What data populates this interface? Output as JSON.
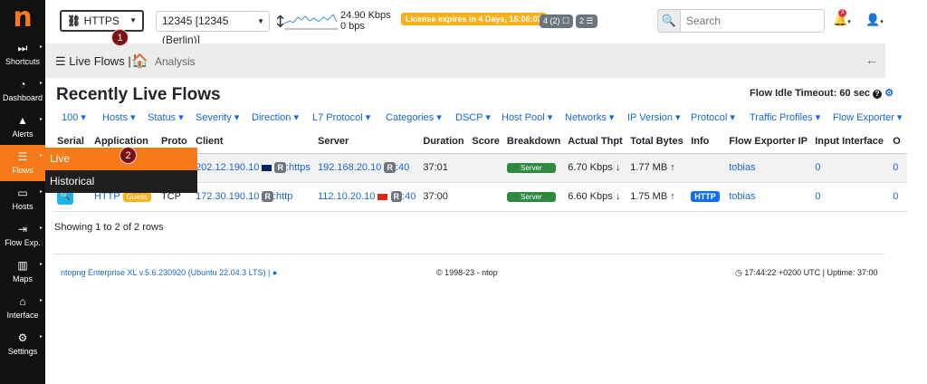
{
  "sidebar": {
    "logo": "n",
    "items": [
      {
        "label": "Shortcuts",
        "icon": "fast-forward-icon"
      },
      {
        "label": "Dashboard",
        "icon": "gauge-icon"
      },
      {
        "label": "Alerts",
        "icon": "warning-icon"
      },
      {
        "label": "Flows",
        "icon": "menu-icon"
      },
      {
        "label": "Hosts",
        "icon": "laptop-icon"
      },
      {
        "label": "Flow Exp.",
        "icon": "export-icon"
      },
      {
        "label": "Maps",
        "icon": "map-icon"
      },
      {
        "label": "Interface",
        "icon": "ethernet-icon"
      },
      {
        "label": "Settings",
        "icon": "gear-icon"
      }
    ],
    "flyout": [
      "Live",
      "Historical"
    ]
  },
  "topbar": {
    "interface": "HTTPS",
    "host_pool": "12345 [12345 (Berlin)]",
    "throughput_up": "24.90 Kbps",
    "throughput_down": "0 bps",
    "license": "License expires in 4 Days, 16:06:03",
    "pill1": "4 (2) ☐",
    "pill2": "2 ☰",
    "search_placeholder": "Search",
    "notification_count": "3"
  },
  "markers": [
    "1",
    "2"
  ],
  "breadcrumb": {
    "section": "Live Flows",
    "page": "Analysis"
  },
  "page_title": "Recently Live Flows",
  "idle_timeout": "Flow Idle Timeout: 60 sec",
  "filters": [
    "100 ▾",
    "Hosts ▾",
    "Status ▾",
    "Severity ▾",
    "Direction ▾",
    "L7 Protocol ▾",
    "Categories ▾",
    "DSCP ▾",
    "Host Pool ▾",
    "Networks ▾",
    "IP Version ▾",
    "Protocol ▾",
    "Traffic Profiles ▾",
    "Flow Exporter ▾"
  ],
  "table": {
    "headers": [
      "Serial",
      "Application",
      "Proto",
      "Client",
      "Server",
      "Duration",
      "Score",
      "Breakdown",
      "Actual Thpt",
      "Total Bytes",
      "Info",
      "Flow Exporter IP",
      "Input Interface",
      "O"
    ],
    "rows": [
      {
        "app": "",
        "app_badge": "",
        "proto": "",
        "client": "202.12.190.10",
        "client_port": ":https",
        "server": "192.168.20.10",
        "server_port": ":40",
        "duration": "37:01",
        "score": "",
        "breakdown": "Server",
        "thpt": "6.70 Kbps ↓",
        "bytes": "1.77 MB ↑",
        "info": "",
        "exporter": "tobias",
        "in_if": "0",
        "out_if": "0"
      },
      {
        "app": "HTTP",
        "app_badge": "Guess",
        "proto": "TCP",
        "client": "172.30.190.10",
        "client_port": ":http",
        "server": "112.10.20.10",
        "server_port": ":40",
        "duration": "37:00",
        "score": "",
        "breakdown": "Server",
        "thpt": "6.60 Kbps ↓",
        "bytes": "1.75 MB ↑",
        "info": "HTTP",
        "exporter": "tobias",
        "in_if": "0",
        "out_if": "0"
      }
    ]
  },
  "showing": "Showing 1 to 2 of 2 rows",
  "footer": {
    "version": "ntopng Enterprise XL v.5.6.230920 (Ubuntu 22.04.3 LTS) |",
    "copyright": "© 1998-23 - ntop",
    "clock": "17:44:22 +0200 UTC | Uptime: 37:00"
  },
  "colors": {
    "accent": "#f77a1a",
    "link": "#1967d2",
    "license": "#f7b11a"
  }
}
